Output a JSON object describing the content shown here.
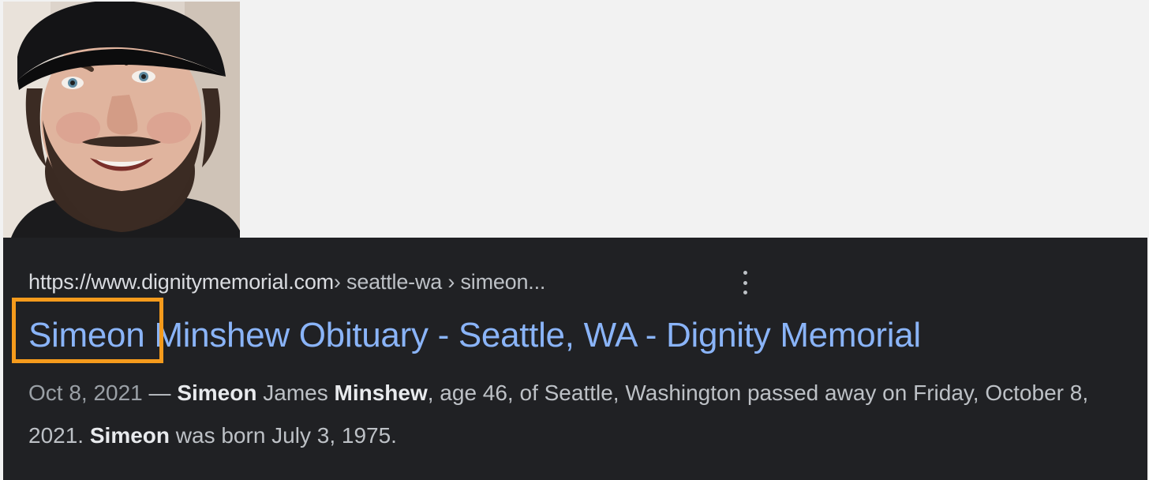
{
  "photo": {
    "icon": "profile-photo"
  },
  "result": {
    "url_main": "https://www.dignitymemorial.com",
    "url_path": " › seattle-wa › simeon...",
    "title_highlighted": "Simeon",
    "title_rest": " Minshew Obituary - Seattle, WA - Dignity Memorial",
    "snippet": {
      "date": "Oct 8, 2021",
      "dash": " — ",
      "name1": "Simeon",
      "text1": " James ",
      "name2": "Minshew",
      "text2": ", age 46, of Seattle, Washington passed away on Friday, October 8, 2021. ",
      "name3": "Simeon",
      "text3": " was born July 3, 1975."
    },
    "more_icon": "more-vert-icon"
  },
  "colors": {
    "card_background": "#202124",
    "link": "#8ab4f8",
    "highlight_box": "#f59b1c",
    "page_background": "#f2f2f2"
  }
}
